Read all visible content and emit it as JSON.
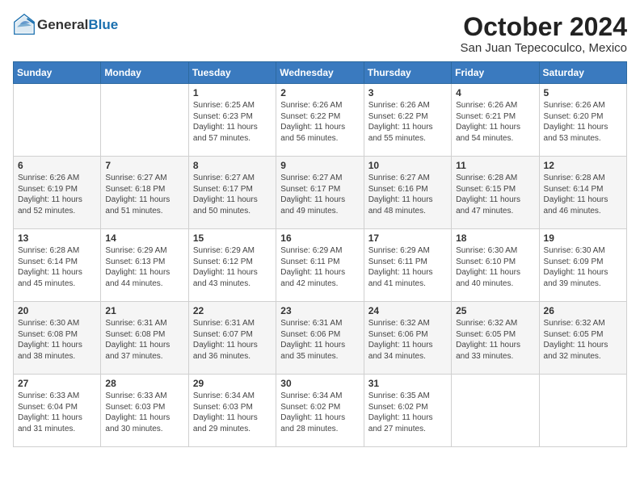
{
  "header": {
    "logo_general": "General",
    "logo_blue": "Blue",
    "title": "October 2024",
    "subtitle": "San Juan Tepecoculco, Mexico"
  },
  "days_of_week": [
    "Sunday",
    "Monday",
    "Tuesday",
    "Wednesday",
    "Thursday",
    "Friday",
    "Saturday"
  ],
  "weeks": [
    [
      {
        "num": "",
        "info": ""
      },
      {
        "num": "",
        "info": ""
      },
      {
        "num": "1",
        "info": "Sunrise: 6:25 AM\nSunset: 6:23 PM\nDaylight: 11 hours and 57 minutes."
      },
      {
        "num": "2",
        "info": "Sunrise: 6:26 AM\nSunset: 6:22 PM\nDaylight: 11 hours and 56 minutes."
      },
      {
        "num": "3",
        "info": "Sunrise: 6:26 AM\nSunset: 6:22 PM\nDaylight: 11 hours and 55 minutes."
      },
      {
        "num": "4",
        "info": "Sunrise: 6:26 AM\nSunset: 6:21 PM\nDaylight: 11 hours and 54 minutes."
      },
      {
        "num": "5",
        "info": "Sunrise: 6:26 AM\nSunset: 6:20 PM\nDaylight: 11 hours and 53 minutes."
      }
    ],
    [
      {
        "num": "6",
        "info": "Sunrise: 6:26 AM\nSunset: 6:19 PM\nDaylight: 11 hours and 52 minutes."
      },
      {
        "num": "7",
        "info": "Sunrise: 6:27 AM\nSunset: 6:18 PM\nDaylight: 11 hours and 51 minutes."
      },
      {
        "num": "8",
        "info": "Sunrise: 6:27 AM\nSunset: 6:17 PM\nDaylight: 11 hours and 50 minutes."
      },
      {
        "num": "9",
        "info": "Sunrise: 6:27 AM\nSunset: 6:17 PM\nDaylight: 11 hours and 49 minutes."
      },
      {
        "num": "10",
        "info": "Sunrise: 6:27 AM\nSunset: 6:16 PM\nDaylight: 11 hours and 48 minutes."
      },
      {
        "num": "11",
        "info": "Sunrise: 6:28 AM\nSunset: 6:15 PM\nDaylight: 11 hours and 47 minutes."
      },
      {
        "num": "12",
        "info": "Sunrise: 6:28 AM\nSunset: 6:14 PM\nDaylight: 11 hours and 46 minutes."
      }
    ],
    [
      {
        "num": "13",
        "info": "Sunrise: 6:28 AM\nSunset: 6:14 PM\nDaylight: 11 hours and 45 minutes."
      },
      {
        "num": "14",
        "info": "Sunrise: 6:29 AM\nSunset: 6:13 PM\nDaylight: 11 hours and 44 minutes."
      },
      {
        "num": "15",
        "info": "Sunrise: 6:29 AM\nSunset: 6:12 PM\nDaylight: 11 hours and 43 minutes."
      },
      {
        "num": "16",
        "info": "Sunrise: 6:29 AM\nSunset: 6:11 PM\nDaylight: 11 hours and 42 minutes."
      },
      {
        "num": "17",
        "info": "Sunrise: 6:29 AM\nSunset: 6:11 PM\nDaylight: 11 hours and 41 minutes."
      },
      {
        "num": "18",
        "info": "Sunrise: 6:30 AM\nSunset: 6:10 PM\nDaylight: 11 hours and 40 minutes."
      },
      {
        "num": "19",
        "info": "Sunrise: 6:30 AM\nSunset: 6:09 PM\nDaylight: 11 hours and 39 minutes."
      }
    ],
    [
      {
        "num": "20",
        "info": "Sunrise: 6:30 AM\nSunset: 6:08 PM\nDaylight: 11 hours and 38 minutes."
      },
      {
        "num": "21",
        "info": "Sunrise: 6:31 AM\nSunset: 6:08 PM\nDaylight: 11 hours and 37 minutes."
      },
      {
        "num": "22",
        "info": "Sunrise: 6:31 AM\nSunset: 6:07 PM\nDaylight: 11 hours and 36 minutes."
      },
      {
        "num": "23",
        "info": "Sunrise: 6:31 AM\nSunset: 6:06 PM\nDaylight: 11 hours and 35 minutes."
      },
      {
        "num": "24",
        "info": "Sunrise: 6:32 AM\nSunset: 6:06 PM\nDaylight: 11 hours and 34 minutes."
      },
      {
        "num": "25",
        "info": "Sunrise: 6:32 AM\nSunset: 6:05 PM\nDaylight: 11 hours and 33 minutes."
      },
      {
        "num": "26",
        "info": "Sunrise: 6:32 AM\nSunset: 6:05 PM\nDaylight: 11 hours and 32 minutes."
      }
    ],
    [
      {
        "num": "27",
        "info": "Sunrise: 6:33 AM\nSunset: 6:04 PM\nDaylight: 11 hours and 31 minutes."
      },
      {
        "num": "28",
        "info": "Sunrise: 6:33 AM\nSunset: 6:03 PM\nDaylight: 11 hours and 30 minutes."
      },
      {
        "num": "29",
        "info": "Sunrise: 6:34 AM\nSunset: 6:03 PM\nDaylight: 11 hours and 29 minutes."
      },
      {
        "num": "30",
        "info": "Sunrise: 6:34 AM\nSunset: 6:02 PM\nDaylight: 11 hours and 28 minutes."
      },
      {
        "num": "31",
        "info": "Sunrise: 6:35 AM\nSunset: 6:02 PM\nDaylight: 11 hours and 27 minutes."
      },
      {
        "num": "",
        "info": ""
      },
      {
        "num": "",
        "info": ""
      }
    ]
  ]
}
